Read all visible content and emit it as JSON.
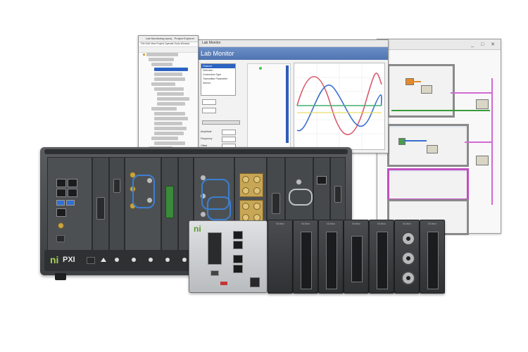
{
  "project_window": {
    "title": "Lab Monitoring.lvproj - Project Explorer",
    "menu": "File  Edit  View  Project  Operate  Tools  Window",
    "tree_label": "Project: Lab Monitoring.lvproj"
  },
  "lab_monitor": {
    "window_title": "Lab Monitor",
    "header": "Lab Monitor",
    "control_list": [
      "Channel",
      "Selection",
      "Connection Type",
      "Transmitter Parameter",
      "Sensor"
    ],
    "fields": [
      "Amplitude",
      "Frequency",
      "Offset"
    ]
  },
  "chassis": {
    "logo": "ni",
    "brand": "PXI"
  },
  "crio": {
    "logo": "ni",
    "module_labels": [
      "NI-9xxx",
      "NI-9xxx",
      "NI-9xxx",
      "NI-9xxx",
      "NI-9xxx",
      "NI-9xxx",
      "NI-9xxx"
    ]
  },
  "colors": {
    "accent_blue": "#2b63c2",
    "wire_pink": "#d16ad2",
    "ni_green": "#a9d15b"
  }
}
